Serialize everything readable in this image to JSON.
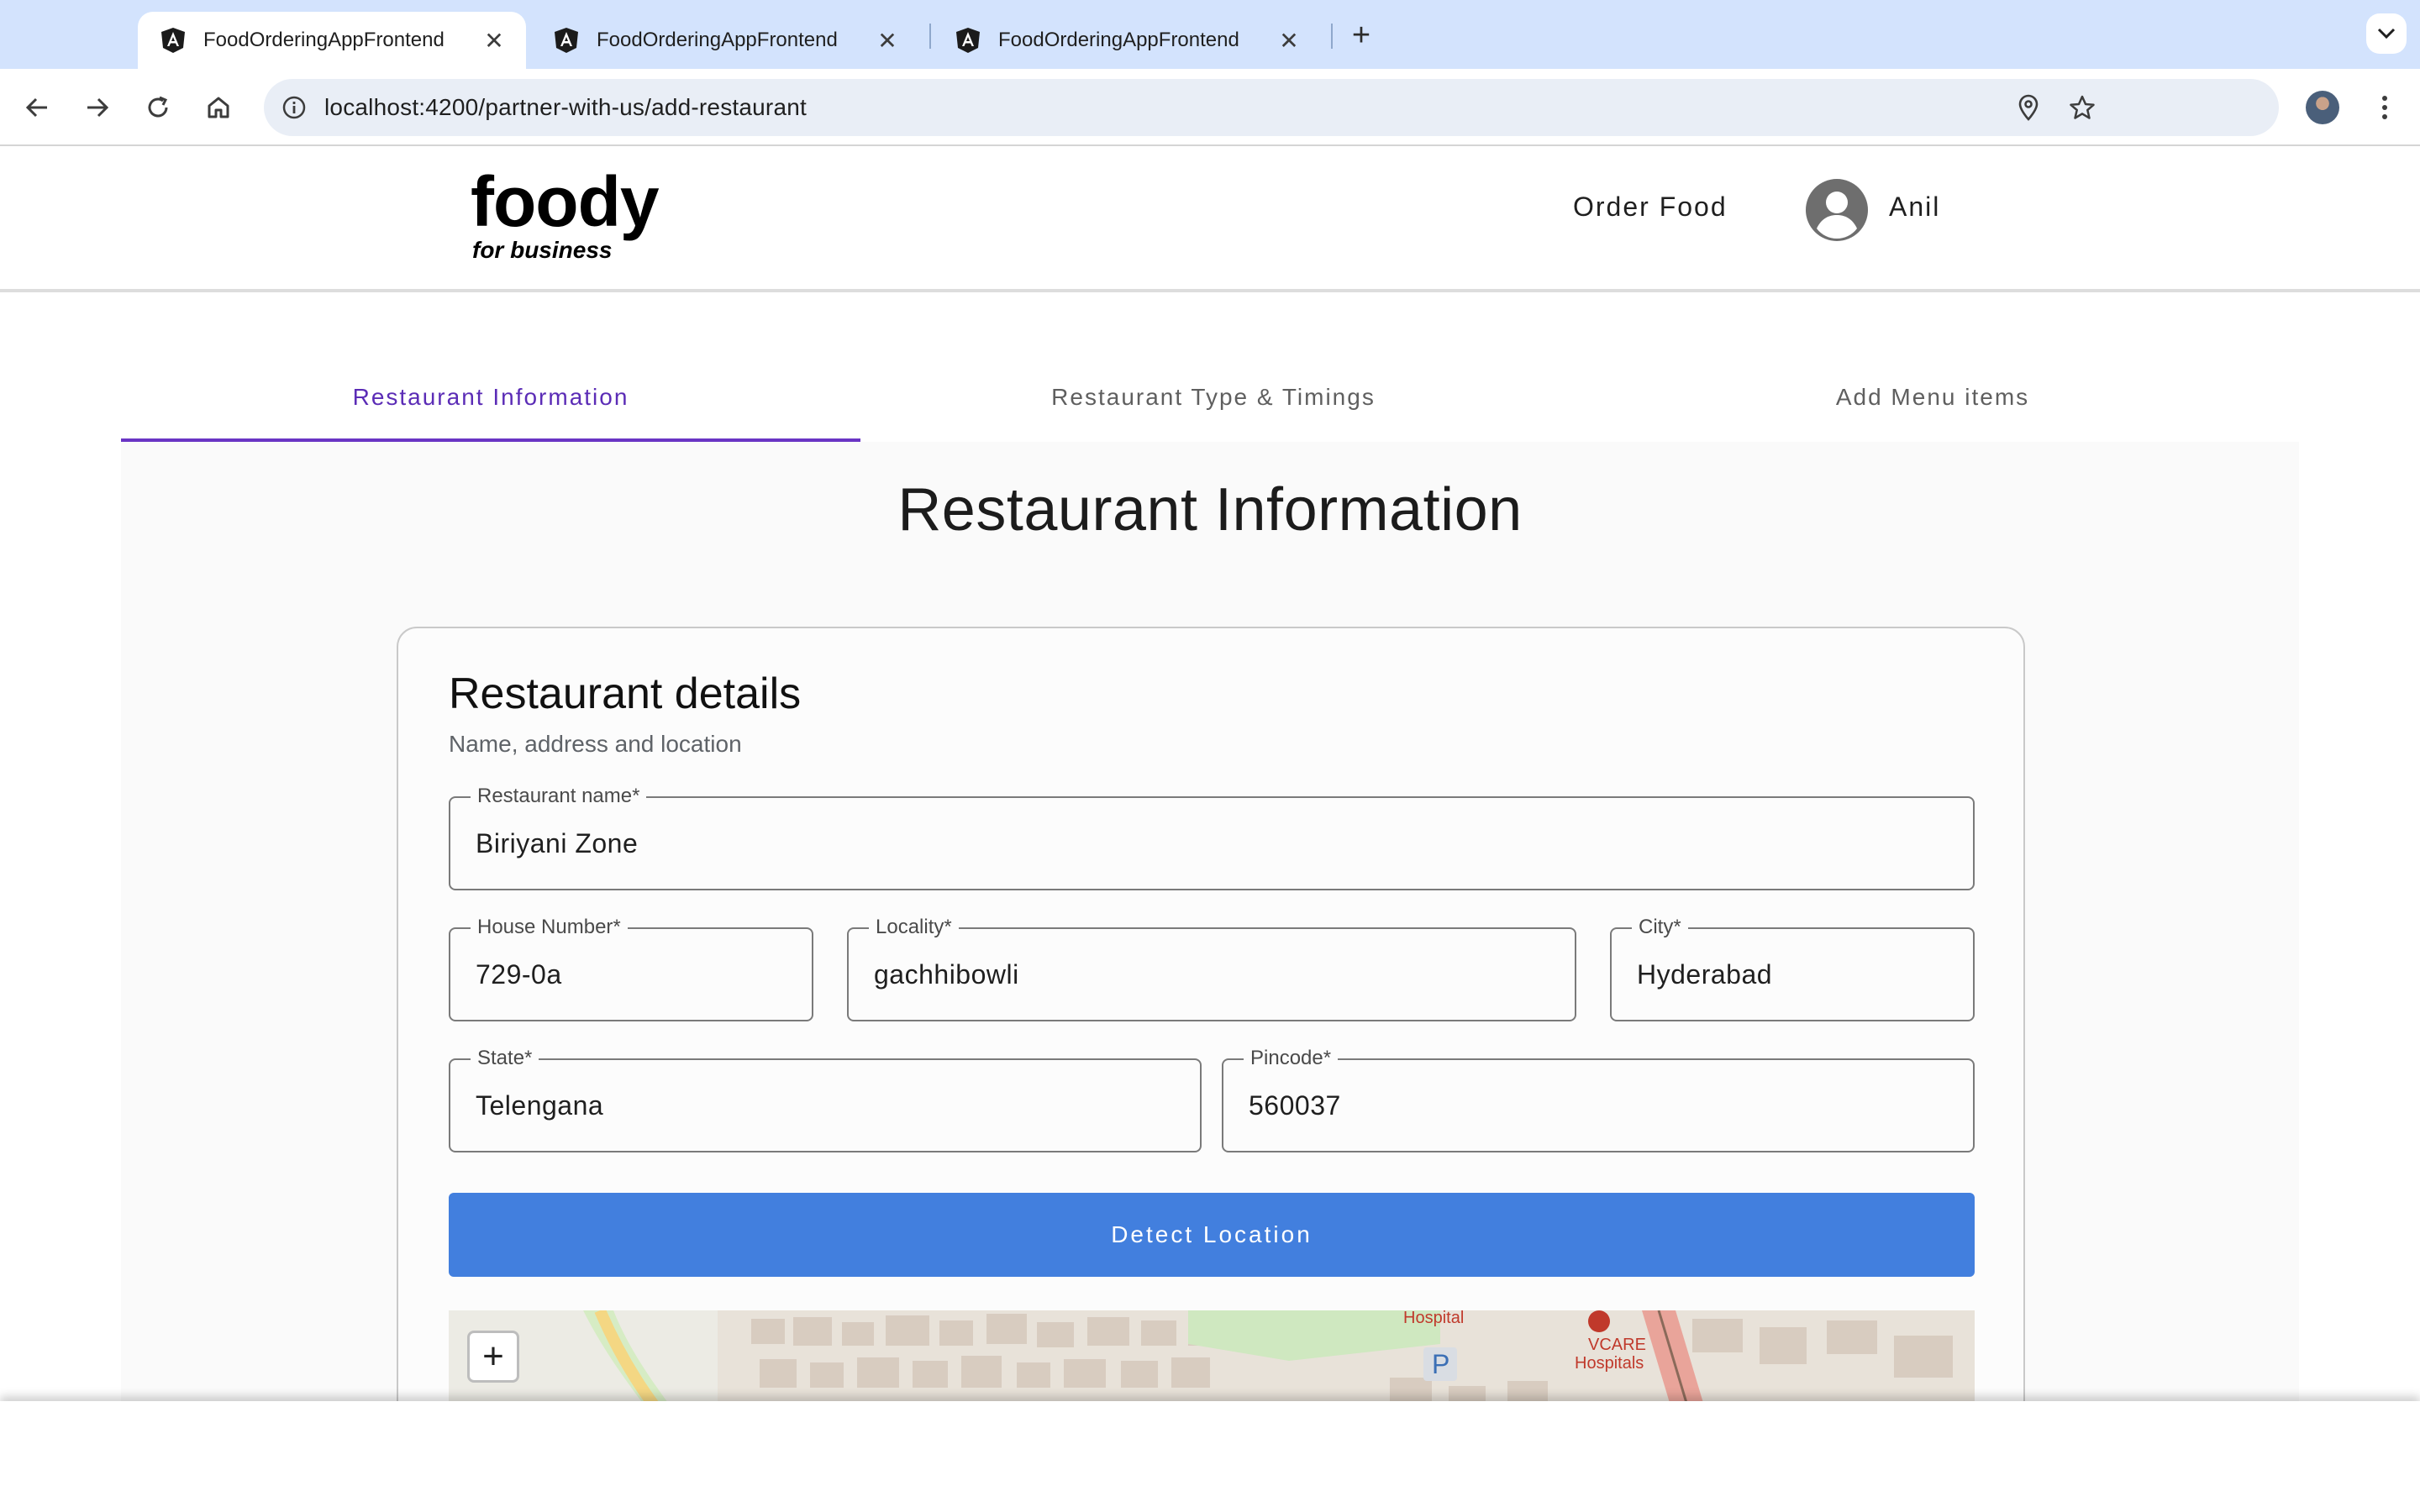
{
  "browser": {
    "tabs": [
      {
        "title": "FoodOrderingAppFrontend",
        "active": true
      },
      {
        "title": "FoodOrderingAppFrontend",
        "active": false
      },
      {
        "title": "FoodOrderingAppFrontend",
        "active": false
      }
    ],
    "url": "localhost:4200/partner-with-us/add-restaurant"
  },
  "header": {
    "logo_main": "foody",
    "logo_sub": "for business",
    "order_food": "Order Food",
    "user_name": "Anil"
  },
  "steps": [
    {
      "label": "Restaurant Information",
      "active": true
    },
    {
      "label": "Restaurant Type & Timings",
      "active": false
    },
    {
      "label": "Add Menu items",
      "active": false
    }
  ],
  "page": {
    "heading": "Restaurant Information"
  },
  "card": {
    "title": "Restaurant details",
    "subtitle": "Name, address and location"
  },
  "form": {
    "restaurant_name": {
      "label": "Restaurant name*",
      "value": "Biriyani Zone"
    },
    "house_number": {
      "label": "House Number*",
      "value": "729-0a"
    },
    "locality": {
      "label": "Locality*",
      "value": "gachhibowli"
    },
    "city": {
      "label": "City*",
      "value": "Hyderabad"
    },
    "state": {
      "label": "State*",
      "value": "Telengana"
    },
    "pincode": {
      "label": "Pincode*",
      "value": "560037"
    },
    "detect_location": "Detect Location"
  },
  "map": {
    "zoom_in": "+",
    "labels": {
      "hospital": "Hospital",
      "vcare": "VCARE",
      "hospitals": "Hospitals",
      "parking": "P"
    }
  },
  "colors": {
    "accent": "#6a35c4",
    "button": "#427fde",
    "tabbar": "#d3e3fd"
  }
}
